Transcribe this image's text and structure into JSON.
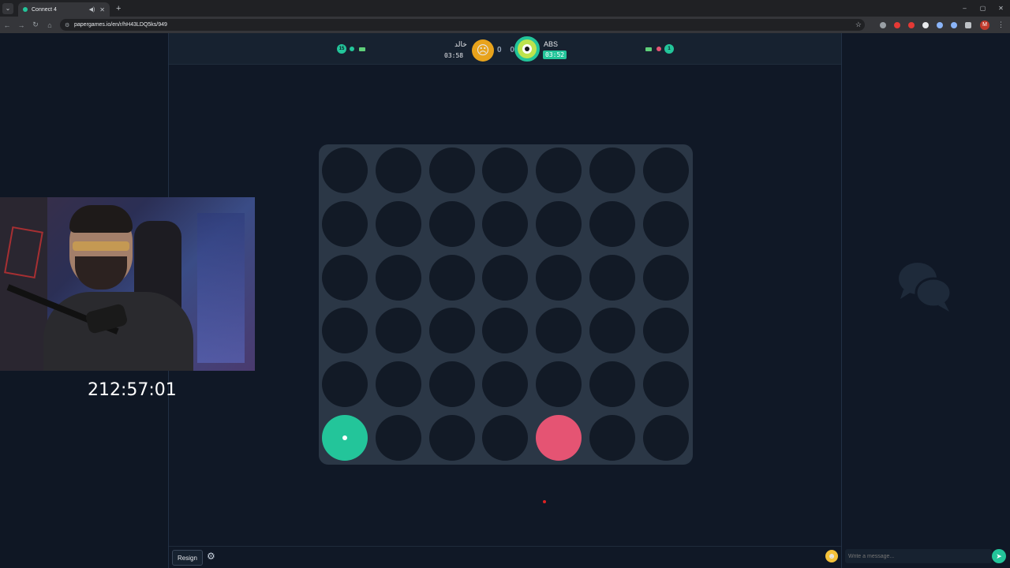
{
  "browser": {
    "tab_title": "Connect 4",
    "tab_close": "✕",
    "new_tab": "+",
    "url": "papergames.io/en/r/hH43LDQ5ks/949",
    "window_controls": [
      "–",
      "▢",
      "✕"
    ],
    "profile_initial": "M",
    "extension_colors": [
      "#9aa0a6",
      "#e53935",
      "#e53935",
      "#e8eaed",
      "#8ab4f8",
      "#8ab4f8",
      "#bdc1c6"
    ]
  },
  "game": {
    "left_series_count": "15",
    "right_series_count": "1",
    "player1": {
      "name": "خالد",
      "time": "03:58",
      "color": "#e55473"
    },
    "player2": {
      "name": "ABS",
      "time": "03:52",
      "color": "#23c59a"
    },
    "score": "0 0",
    "board": {
      "rows": 6,
      "cols": 7,
      "pieces": [
        {
          "row": 5,
          "col": 0,
          "color": "green",
          "last_move": true
        },
        {
          "row": 5,
          "col": 4,
          "color": "red",
          "last_move": false
        }
      ]
    },
    "footer": {
      "resign_label": "Resign"
    }
  },
  "chat": {
    "placeholder": "Write a message..."
  },
  "stream": {
    "timer": "212:57:01"
  },
  "colors": {
    "accent": "#23c59a",
    "opponent": "#e55473",
    "board": "#2b3746",
    "background": "#0f1724"
  }
}
